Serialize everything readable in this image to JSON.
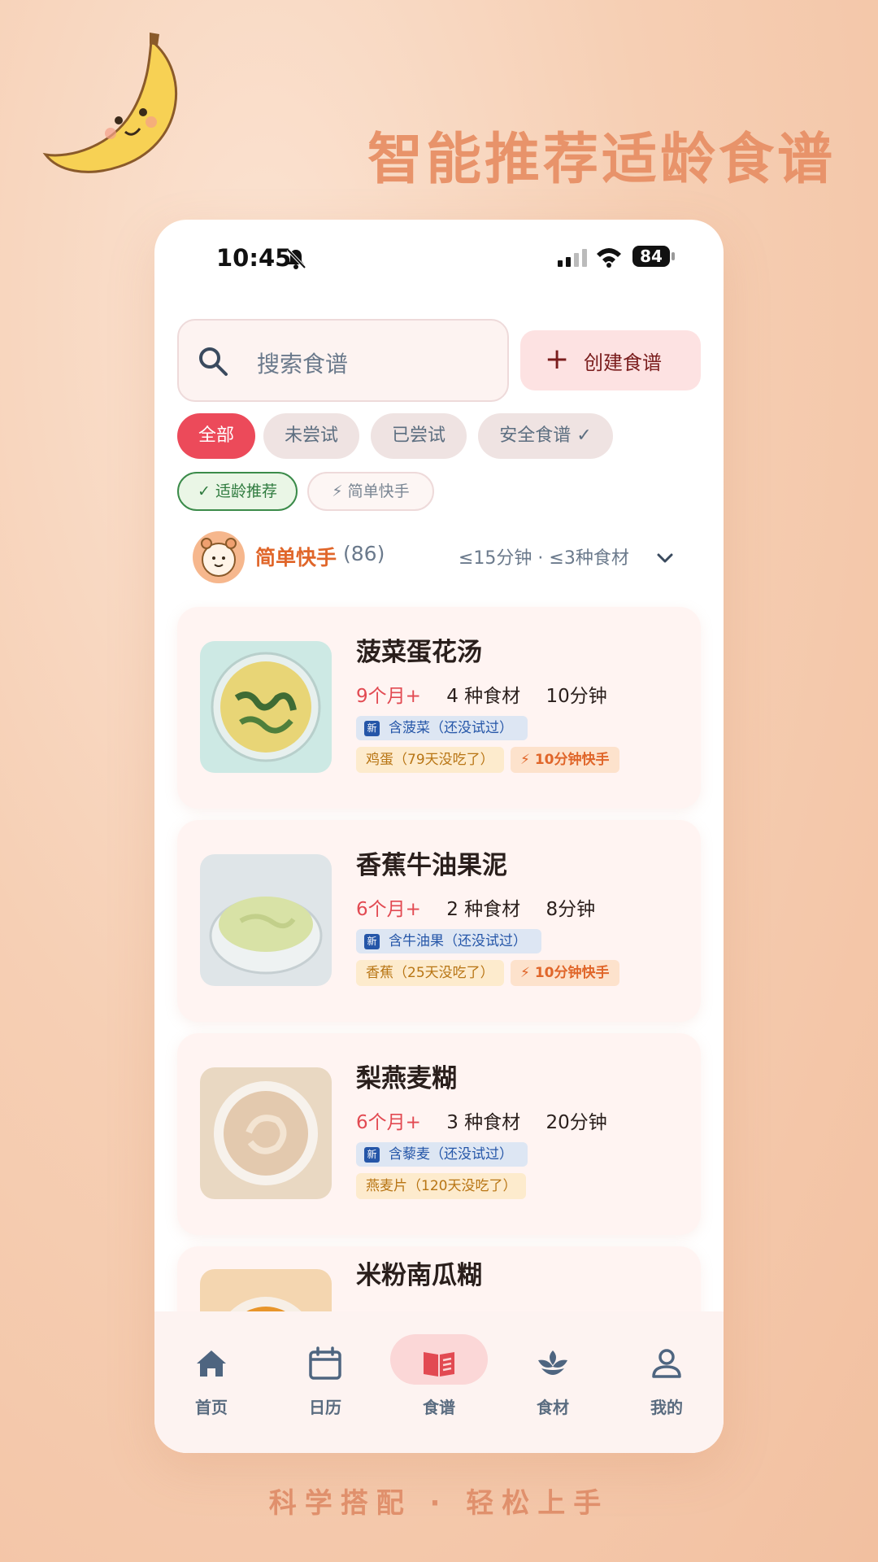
{
  "headline": "智能推荐适龄食谱",
  "footer_slogan": "科学搭配 · 轻松上手",
  "status_bar": {
    "time": "10:45",
    "battery": "84"
  },
  "search": {
    "placeholder": "搜索食谱"
  },
  "create_button": {
    "label": "创建食谱"
  },
  "filters": [
    {
      "label": "全部",
      "active": true
    },
    {
      "label": "未尝试",
      "active": false
    },
    {
      "label": "已尝试",
      "active": false
    },
    {
      "label": "安全食谱 ✓",
      "active": false
    }
  ],
  "secondary_filters": [
    {
      "label": "✓ 适龄推荐",
      "active": true
    },
    {
      "label": "⚡ 简单快手",
      "active": false
    }
  ],
  "category": {
    "title": "简单快手",
    "count": "(86)",
    "criteria": "≤15分钟 · ≤3种食材"
  },
  "recipes": [
    {
      "title": "菠菜蛋花汤",
      "age": "9个月+",
      "ingredients": "4 种食材",
      "time": "10分钟",
      "new_tag": "含菠菜（还没试过）",
      "old_tag": "鸡蛋（79天没吃了）",
      "quick_tag": "⚡ 10分钟快手"
    },
    {
      "title": "香蕉牛油果泥",
      "age": "6个月+",
      "ingredients": "2 种食材",
      "time": "8分钟",
      "new_tag": "含牛油果（还没试过）",
      "old_tag": "香蕉（25天没吃了）",
      "quick_tag": "⚡ 10分钟快手"
    },
    {
      "title": "梨燕麦糊",
      "age": "6个月+",
      "ingredients": "3 种食材",
      "time": "20分钟",
      "new_tag": "含藜麦（还没试过）",
      "old_tag": "燕麦片（120天没吃了）",
      "quick_tag": ""
    },
    {
      "title": "米粉南瓜糊",
      "age": "",
      "ingredients": "",
      "time": "",
      "new_tag": "",
      "old_tag": "",
      "quick_tag": ""
    }
  ],
  "new_badge": "新",
  "tabs": [
    {
      "label": "首页",
      "icon": "home-icon"
    },
    {
      "label": "日历",
      "icon": "calendar-icon"
    },
    {
      "label": "食谱",
      "icon": "book-icon",
      "active": true
    },
    {
      "label": "食材",
      "icon": "sprout-icon"
    },
    {
      "label": "我的",
      "icon": "profile-icon"
    }
  ],
  "colors": {
    "accent": "#ec4a5a",
    "orange": "#e0662a",
    "headline": "#e8936a"
  }
}
